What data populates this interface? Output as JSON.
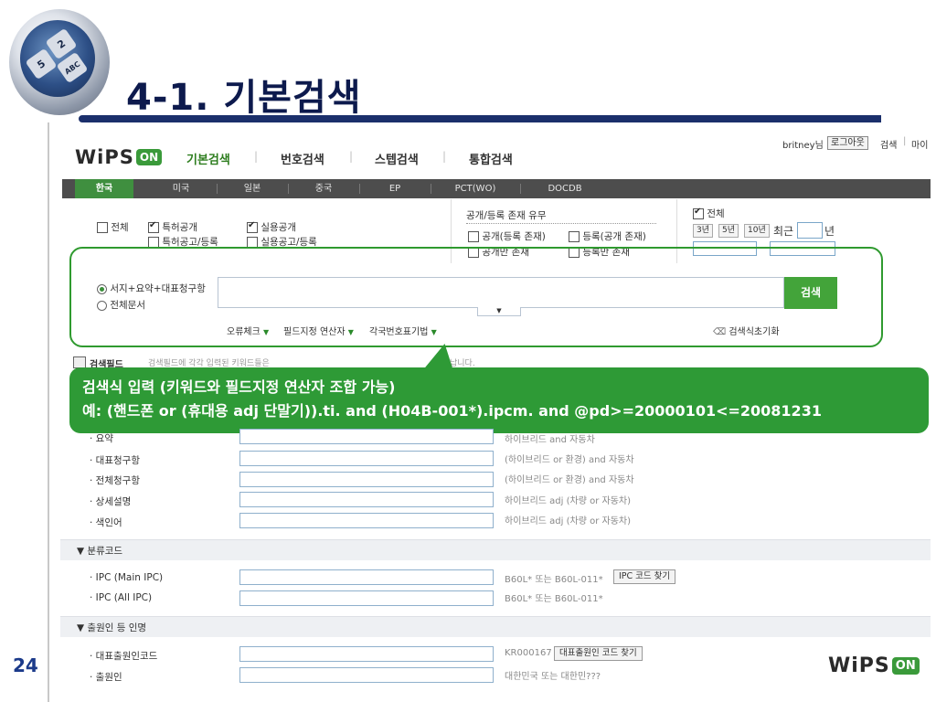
{
  "slide": {
    "title": "4-1. 기본검색",
    "page_number": "24",
    "decor_keys": [
      "2",
      "ABC",
      "5"
    ]
  },
  "app": {
    "logo_word": "WiPS",
    "logo_on": "ON",
    "main_tabs": [
      "기본검색",
      "번호검색",
      "스텝검색",
      "통합검색"
    ],
    "active_tab": "기본검색",
    "user_label": "britney님",
    "logout_label": "로그아웃",
    "top_links": [
      "검색",
      "마이"
    ]
  },
  "countries": [
    "한국",
    "미국",
    "일본",
    "중국",
    "EP",
    "PCT(WO)",
    "DOCDB"
  ],
  "options": {
    "all_label": "전체",
    "patent_pub": "특허공개",
    "patent_reg": "특허공고/등록",
    "utility_pub": "실용공개",
    "utility_reg": "실용공고/등록",
    "pub_title": "공개/등록 존재 유무",
    "pub_exists": "공개(등록 존재)",
    "reg_exists": "등록(공개 존재)",
    "pub_only": "공개만 존재",
    "reg_only": "등록만 존재",
    "period_all": "전체",
    "year_buttons": [
      "3년",
      "5년",
      "10년"
    ],
    "recent": "최근",
    "year_unit": "년",
    "tilde": "~"
  },
  "search": {
    "scope_1": "서지+요약+대표청구항",
    "scope_2": "전체문서",
    "button": "검색",
    "query_value": "",
    "tab_arrow": "▼",
    "helpers": [
      "오류체크",
      "필드지정 연산자",
      "각국번호표기법"
    ],
    "reset": "검색식초기화"
  },
  "callout": {
    "line1": "검색식 입력 (키워드와 필드지정 연산자 조합 가능)",
    "line2": "예: (핸드폰 or (휴대용 adj 단말기)).ti. and (H04B-001*).ipcm. and @pd>=20000101<=20081231"
  },
  "fields": {
    "header": "검색필드",
    "header_desc": "검색필드에 각각 입력된 키워드들은",
    "header_end": "납니다.",
    "rows": [
      {
        "label": "· 요약",
        "example": "하이브리드 and 자동차"
      },
      {
        "label": "· 대표청구항",
        "example": "(하이브리드 or 환경) and 자동차"
      },
      {
        "label": "· 전체청구항",
        "example": "(하이브리드 or 환경) and 자동차"
      },
      {
        "label": "· 상세설명",
        "example": "하이브리드 adj (차량 or 자동차)"
      },
      {
        "label": "· 색인어",
        "example": "하이브리드 adj (차량 or 자동차)"
      }
    ]
  },
  "classification": {
    "title": "▼ 분류코드",
    "rows": [
      {
        "label": "· IPC (Main IPC)",
        "example": "B60L* 또는 B60L-011*",
        "button": "IPC 코드 찾기"
      },
      {
        "label": "· IPC (All IPC)",
        "example": "B60L* 또는 B60L-011*"
      }
    ]
  },
  "applicant": {
    "title": "▼ 출원인 등 인명",
    "rows": [
      {
        "label": "· 대표출원인코드",
        "example": "KR000167",
        "button": "대표출원인 코드 찾기"
      },
      {
        "label": "· 출원인",
        "example": "대한민국 또는 대한민???"
      }
    ]
  },
  "colors": {
    "accent_green": "#2e9a36",
    "title_navy": "#0d1a4d",
    "country_bar": "#4d4d4d"
  }
}
